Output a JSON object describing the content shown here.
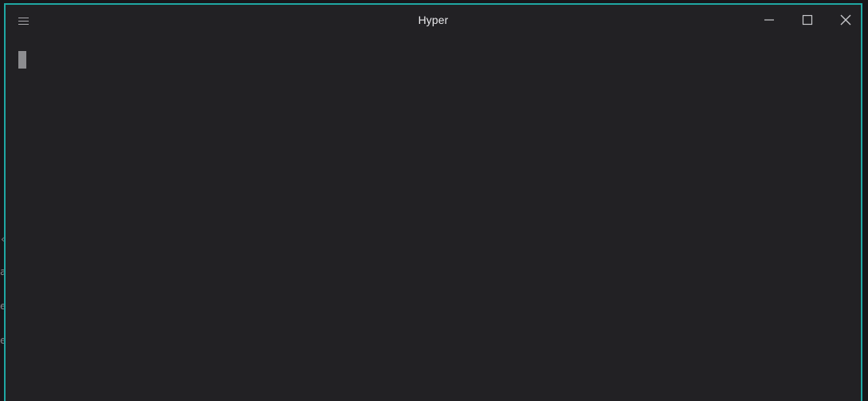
{
  "window": {
    "title": "Hyper",
    "accent_color": "#1fa7a3",
    "background_color": "#222124"
  },
  "titlebar": {
    "menu_icon": "hamburger-menu-icon",
    "controls": [
      {
        "name": "minimize",
        "icon": "minimize-icon"
      },
      {
        "name": "maximize",
        "icon": "maximize-icon"
      },
      {
        "name": "close",
        "icon": "close-icon"
      }
    ]
  },
  "terminal": {
    "cursor_color": "#8d8d90",
    "content": ""
  },
  "background_peek": {
    "glyphs": [
      "‹",
      "a",
      "e",
      "e"
    ]
  }
}
